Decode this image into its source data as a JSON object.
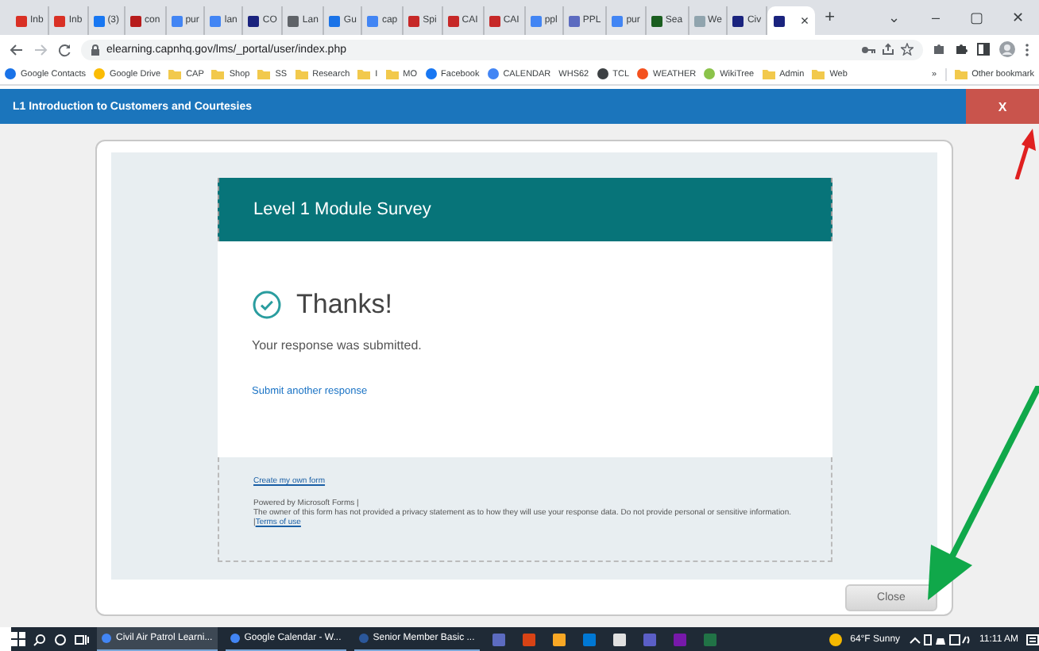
{
  "browser": {
    "tabs": [
      {
        "label": "Inb",
        "color": "#d93025",
        "selected": false
      },
      {
        "label": "Inb",
        "color": "#d93025",
        "selected": false
      },
      {
        "label": "(3)",
        "color": "#1877f2",
        "selected": false
      },
      {
        "label": "con",
        "color": "#b71c1c",
        "selected": false
      },
      {
        "label": "pur",
        "color": "#4285f4",
        "selected": false
      },
      {
        "label": "lan",
        "color": "#4285f4",
        "selected": false
      },
      {
        "label": "CO",
        "color": "#1a237e",
        "selected": false
      },
      {
        "label": "Lan",
        "color": "#5f6368",
        "selected": false
      },
      {
        "label": "Gu",
        "color": "#1a73e8",
        "selected": false
      },
      {
        "label": "cap",
        "color": "#4285f4",
        "selected": false
      },
      {
        "label": "Spi",
        "color": "#c62828",
        "selected": false
      },
      {
        "label": "CAI",
        "color": "#c62828",
        "selected": false
      },
      {
        "label": "CAI",
        "color": "#c62828",
        "selected": false
      },
      {
        "label": "ppl",
        "color": "#4285f4",
        "selected": false
      },
      {
        "label": "PPL",
        "color": "#5c6bc0",
        "selected": false
      },
      {
        "label": "pur",
        "color": "#4285f4",
        "selected": false
      },
      {
        "label": "Sea",
        "color": "#1b5e20",
        "selected": false
      },
      {
        "label": "We",
        "color": "#90a4ae",
        "selected": false
      },
      {
        "label": "Civ",
        "color": "#1a237e",
        "selected": false
      },
      {
        "color": "#1a237e",
        "selected": true
      }
    ],
    "tab_close": "×",
    "new_tab": "+",
    "window_controls": [
      "⌄",
      "–",
      "▢",
      "✕"
    ],
    "url": "elearning.capnhq.gov/lms/_portal/user/index.php",
    "bookmarks": [
      {
        "label": "Google Contacts",
        "kind": "site",
        "color": "#1a73e8"
      },
      {
        "label": "Google Drive",
        "kind": "site",
        "color": "#fbbc04"
      },
      {
        "label": "CAP",
        "kind": "folder"
      },
      {
        "label": "Shop",
        "kind": "folder"
      },
      {
        "label": "SS",
        "kind": "folder"
      },
      {
        "label": "Research",
        "kind": "folder"
      },
      {
        "label": "I",
        "kind": "folder"
      },
      {
        "label": "MO",
        "kind": "folder"
      },
      {
        "label": "Facebook",
        "kind": "site",
        "color": "#1877f2"
      },
      {
        "label": "CALENDAR",
        "kind": "site",
        "color": "#4285f4"
      },
      {
        "label": "WHS62",
        "kind": "text"
      },
      {
        "label": "TCL",
        "kind": "site",
        "color": "#3c4043"
      },
      {
        "label": "WEATHER",
        "kind": "site",
        "color": "#f4511e"
      },
      {
        "label": "WikiTree",
        "kind": "site",
        "color": "#8bc34a"
      },
      {
        "label": "Admin",
        "kind": "folder"
      },
      {
        "label": "Web",
        "kind": "folder"
      }
    ],
    "bookmarks_more": "»",
    "other_bookmarks": "Other bookmark"
  },
  "course": {
    "title": "L1 Introduction to Customers and Courtesies",
    "close": "X"
  },
  "form": {
    "title": "Level 1 Module Survey",
    "heading": "Thanks!",
    "message": "Your response was submitted.",
    "another_link": "Submit another response",
    "create_link": "Create my own form",
    "powered": "Powered by Microsoft Forms |",
    "privacy": "The owner of this form has not provided a privacy statement as to how they will use your response data. Do not provide personal or sensitive information.",
    "terms_prefix": "|",
    "terms_link": "Terms of use"
  },
  "dialog": {
    "close_button": "Close"
  },
  "taskbar": {
    "apps": [
      {
        "label": "Civil Air Patrol Learni...",
        "color": "#4285f4",
        "selected": true
      },
      {
        "label": "Google Calendar - W...",
        "color": "#4285f4",
        "selected": false
      },
      {
        "label": "Senior Member Basic ...",
        "color": "#2b579a",
        "selected": false
      }
    ],
    "pinned": [
      {
        "color": "#5c6bc0"
      },
      {
        "color": "#d84315"
      },
      {
        "color": "#f9a825"
      },
      {
        "color": "#0078d4"
      },
      {
        "color": "#e0e0e0"
      },
      {
        "color": "#5b5fc7"
      },
      {
        "color": "#7719aa"
      },
      {
        "color": "#217346"
      }
    ],
    "weather": "64°F Sunny",
    "time": "11:11 AM"
  }
}
